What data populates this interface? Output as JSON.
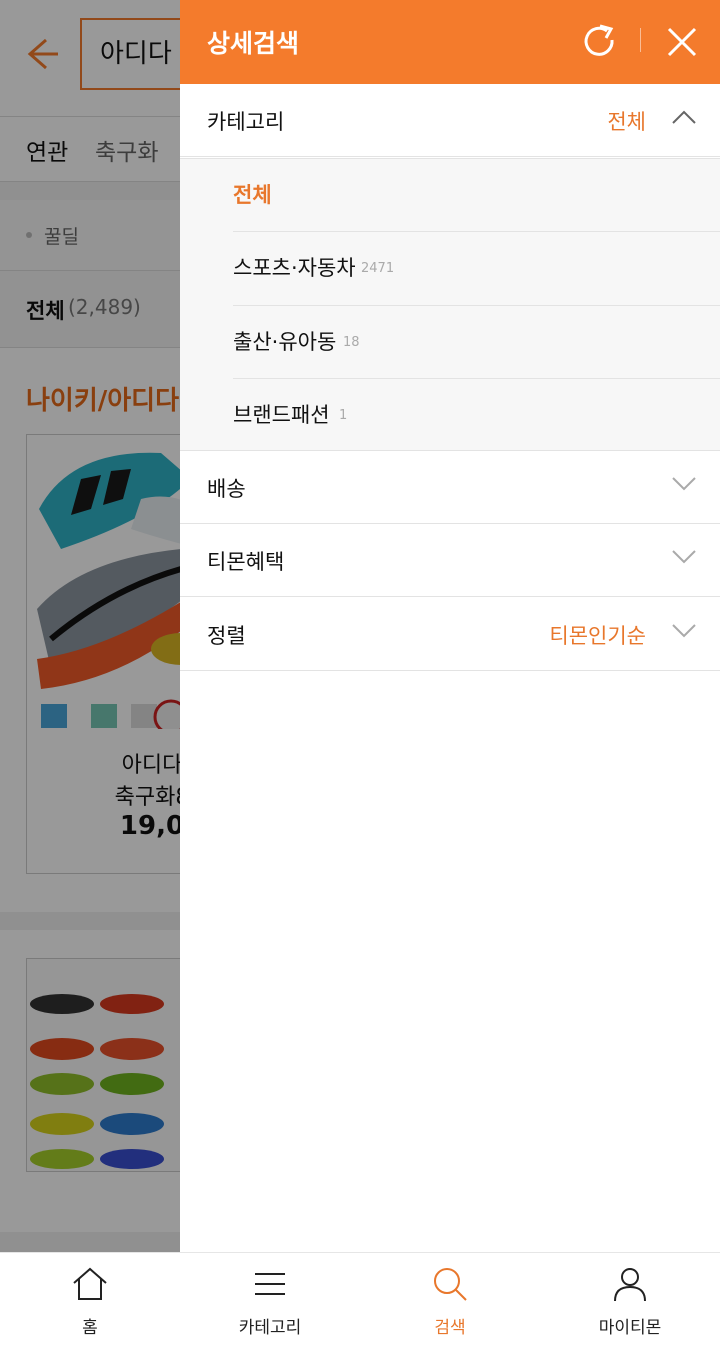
{
  "background": {
    "search_query": "아디다",
    "related": {
      "label": "연관",
      "words": [
        "축구화"
      ]
    },
    "tip": "꿀딜",
    "result_filter": {
      "label": "전체",
      "count": "(2,489)"
    },
    "promo_title": "나이키/아디다",
    "product": {
      "name_line1": "아디다",
      "name_line2": "축구화8",
      "price": "19,0"
    }
  },
  "drawer": {
    "title": "상세검색",
    "refresh_icon": "refresh-icon",
    "close_icon": "close-icon",
    "accent_color": "#f47b2c",
    "sections": {
      "category": {
        "label": "카테고리",
        "value": "전체",
        "expanded": true,
        "items": [
          {
            "name": "전체",
            "count": "",
            "active": true
          },
          {
            "name": "스포츠·자동차",
            "count": "2471",
            "active": false
          },
          {
            "name": "출산·유아동",
            "count": "18",
            "active": false
          },
          {
            "name": "브랜드패션",
            "count": "1",
            "active": false
          }
        ]
      },
      "delivery": {
        "label": "배송",
        "value": ""
      },
      "benefit": {
        "label": "티몬혜택",
        "value": ""
      },
      "sort": {
        "label": "정렬",
        "value": "티몬인기순"
      }
    }
  },
  "bottom_nav": {
    "items": [
      {
        "label": "홈",
        "icon": "home-icon",
        "active": false
      },
      {
        "label": "카테고리",
        "icon": "menu-icon",
        "active": false
      },
      {
        "label": "검색",
        "icon": "search-icon",
        "active": true
      },
      {
        "label": "마이티몬",
        "icon": "user-icon",
        "active": false
      }
    ]
  }
}
